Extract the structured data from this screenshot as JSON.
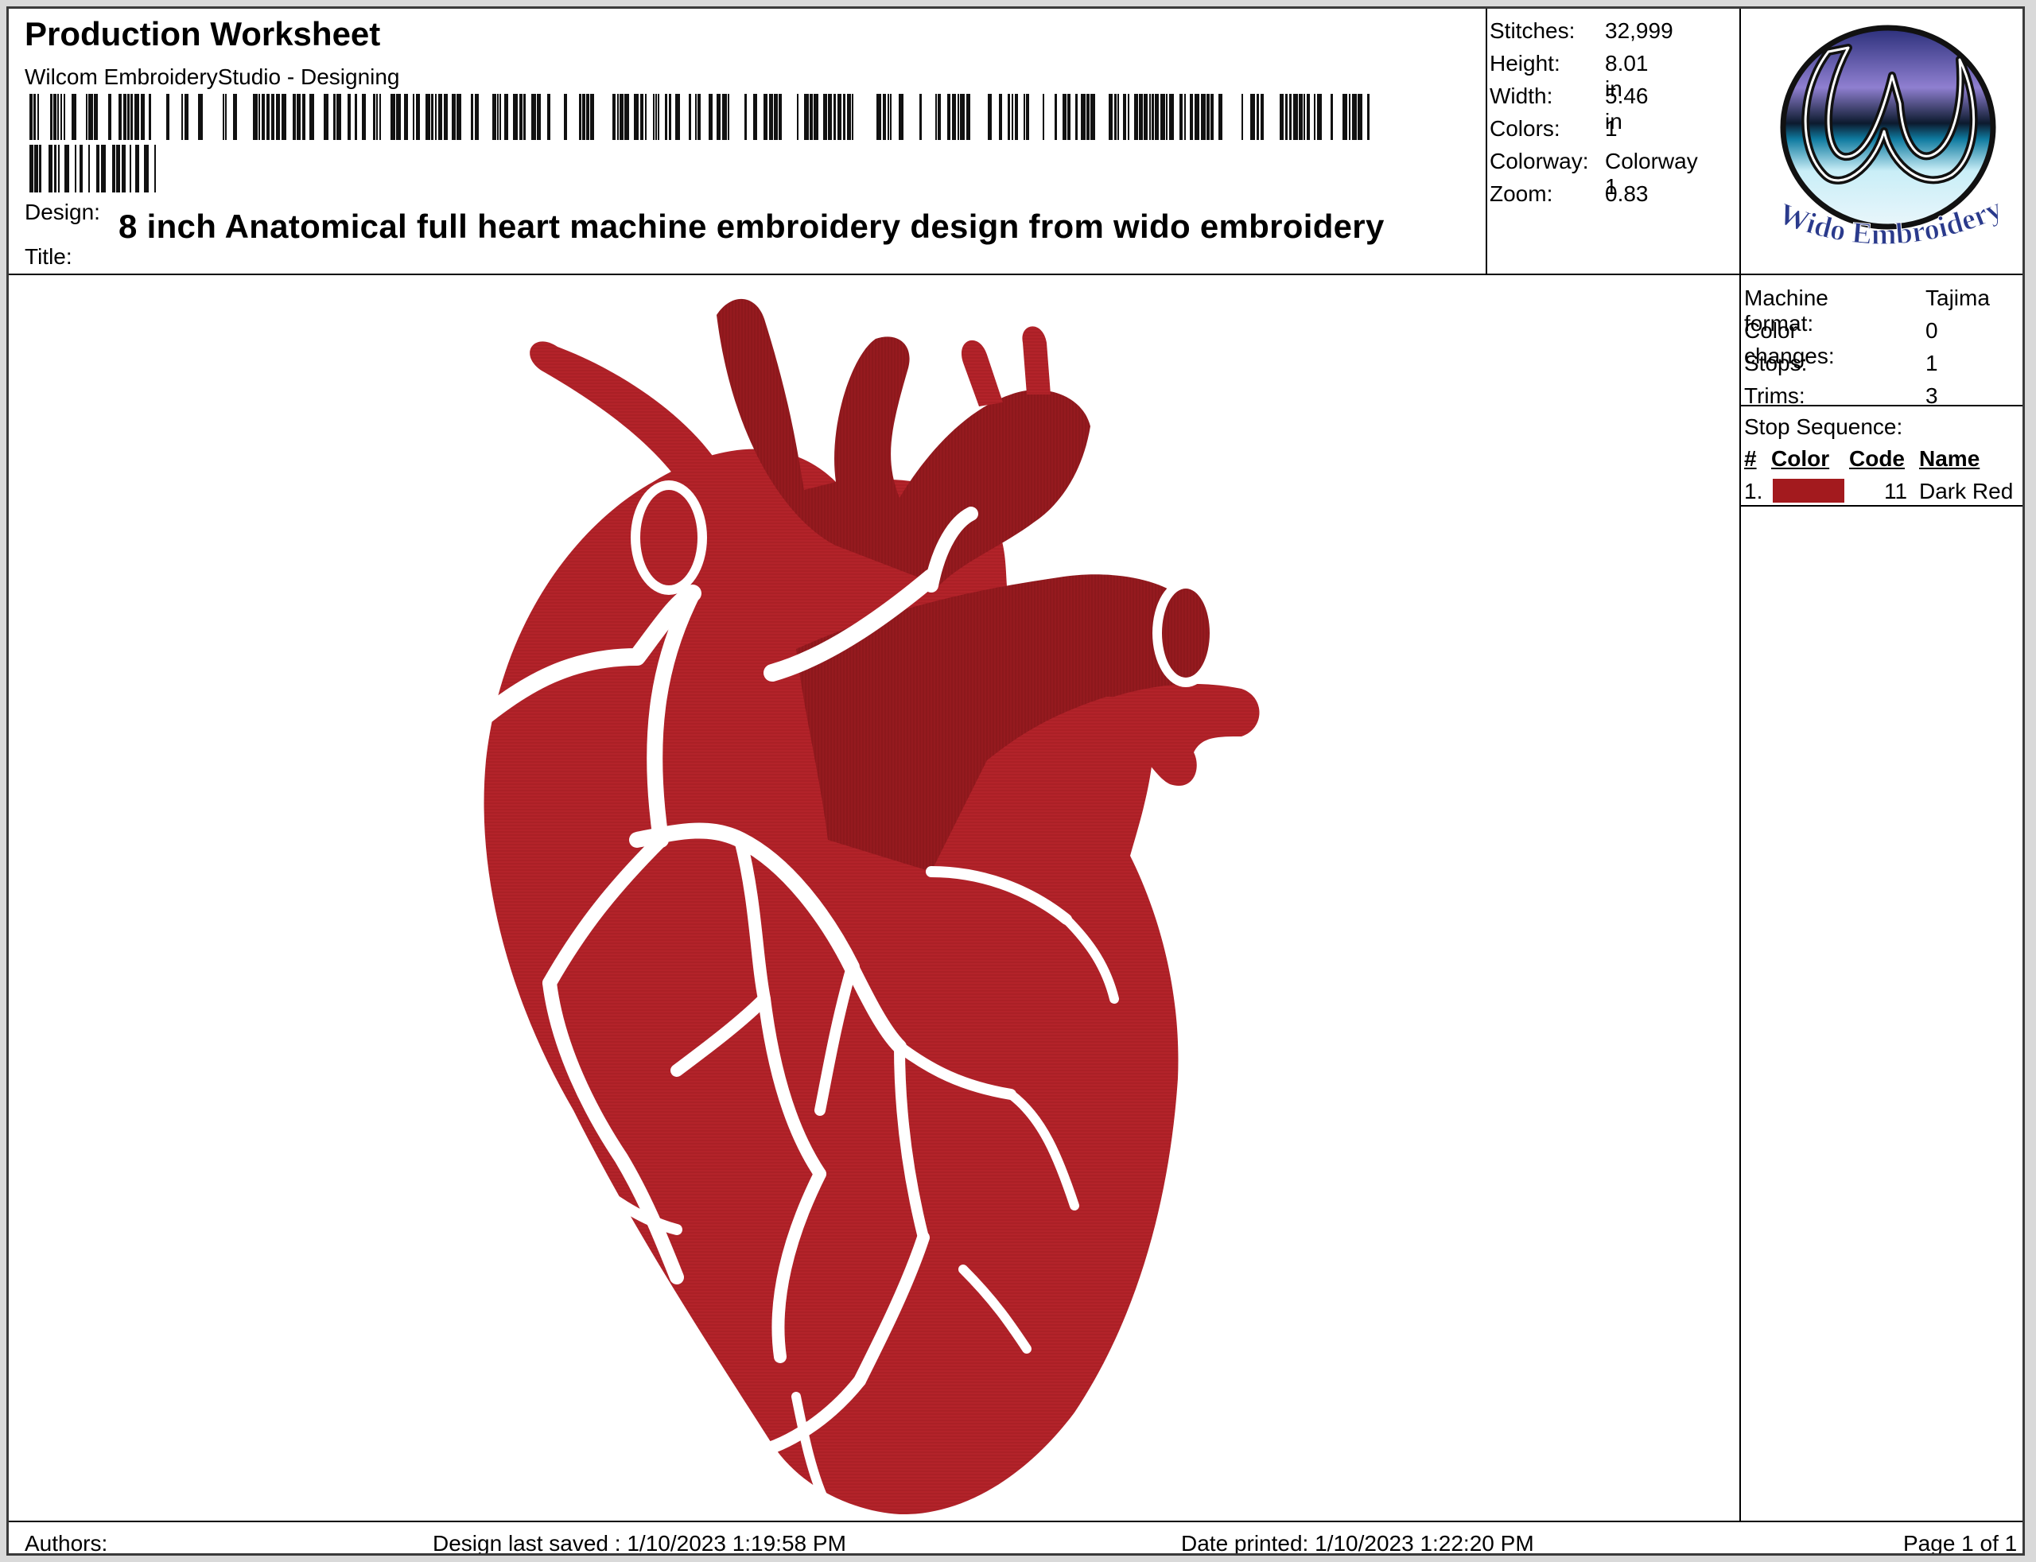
{
  "header": {
    "title": "Production Worksheet",
    "subtitle": "Wilcom EmbroideryStudio - Designing",
    "design_label": "Design:",
    "design_value": "8 inch Anatomical full heart machine embroidery design from wido embroidery",
    "title_label": "Title:"
  },
  "stats": [
    {
      "label": "Stitches:",
      "value": "32,999"
    },
    {
      "label": "Height:",
      "value": "8.01 in"
    },
    {
      "label": "Width:",
      "value": "5.46 in"
    },
    {
      "label": "Colors:",
      "value": "1"
    },
    {
      "label": "Colorway:",
      "value": "Colorway 1"
    },
    {
      "label": "Zoom:",
      "value": "0.83"
    }
  ],
  "logo": {
    "text": "Wido Embroidery",
    "icon": "wido-embroidery-logo"
  },
  "machine": [
    {
      "label": "Machine format:",
      "value": "Tajima"
    },
    {
      "label": "Color changes:",
      "value": "0"
    },
    {
      "label": "Stops:",
      "value": "1"
    },
    {
      "label": "Trims:",
      "value": "3"
    }
  ],
  "stop_sequence": {
    "title": "Stop Sequence:",
    "headers": [
      "#",
      "Color",
      "Code",
      "Name"
    ],
    "rows": [
      {
        "num": "1.",
        "color": "#a31a1e",
        "code": "11",
        "name": "Dark Red"
      }
    ]
  },
  "artwork": {
    "icon": "anatomical-heart-embroidery",
    "color": "#b3232a",
    "dark_color": "#951a1f"
  },
  "footer": {
    "authors": "Authors:",
    "saved": "Design last saved : 1/10/2023 1:19:58 PM",
    "printed": "Date printed: 1/10/2023 1:22:20 PM",
    "page": "Page 1 of 1"
  }
}
